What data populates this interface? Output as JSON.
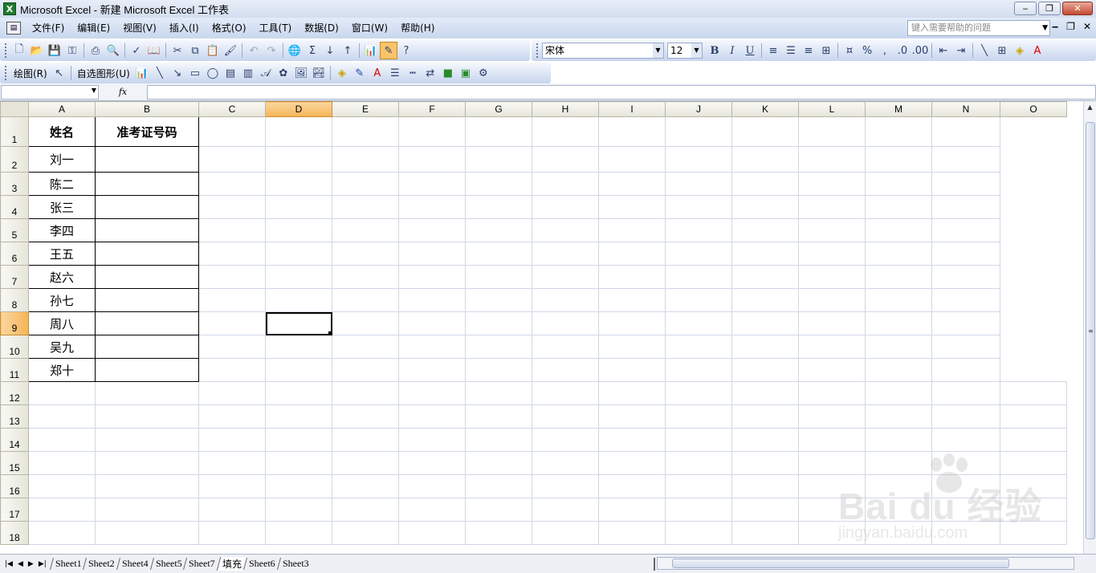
{
  "window": {
    "title": "Microsoft Excel - 新建 Microsoft Excel 工作表",
    "buttons": {
      "minimize": "‒",
      "restore": "❐",
      "close": "✕"
    }
  },
  "menubar": {
    "items": [
      "文件(F)",
      "编辑(E)",
      "视图(V)",
      "插入(I)",
      "格式(O)",
      "工具(T)",
      "数据(D)",
      "窗口(W)",
      "帮助(H)"
    ],
    "help_placeholder": "键入需要帮助的问题"
  },
  "format_toolbar": {
    "font_name": "宋体",
    "font_size": "12",
    "bold": "B",
    "italic": "I",
    "underline": "U"
  },
  "drawing_toolbar": {
    "draw_label": "绘图(R)",
    "autoshapes_label": "自选图形(U)"
  },
  "formula_bar": {
    "name_box": "",
    "fx": "fx",
    "formula": ""
  },
  "sheet": {
    "columns": [
      "A",
      "B",
      "C",
      "D",
      "E",
      "F",
      "G",
      "H",
      "I",
      "J",
      "K",
      "L",
      "M",
      "N",
      "O"
    ],
    "row_numbers": [
      "1",
      "2",
      "3",
      "4",
      "5",
      "6",
      "7",
      "8",
      "9",
      "10",
      "11",
      "12",
      "13",
      "14",
      "15",
      "16",
      "17",
      "18"
    ],
    "selected_column": "D",
    "selected_row": "9",
    "header_a": "姓名",
    "header_b": "准考证号码",
    "names": [
      "刘一",
      "陈二",
      "张三",
      "李四",
      "王五",
      "赵六",
      "孙七",
      "周八",
      "吴九",
      "郑十"
    ]
  },
  "tabs": {
    "items": [
      "Sheet1",
      "Sheet2",
      "Sheet4",
      "Sheet5",
      "Sheet7",
      "填充",
      "Sheet6",
      "Sheet3"
    ],
    "active": "填充"
  },
  "watermark": {
    "logo": "Bai du 经验",
    "url": "jingyan.baidu.com"
  },
  "colors": {
    "selected_header": "#f6b456",
    "excel_green": "#1f7a2f"
  }
}
